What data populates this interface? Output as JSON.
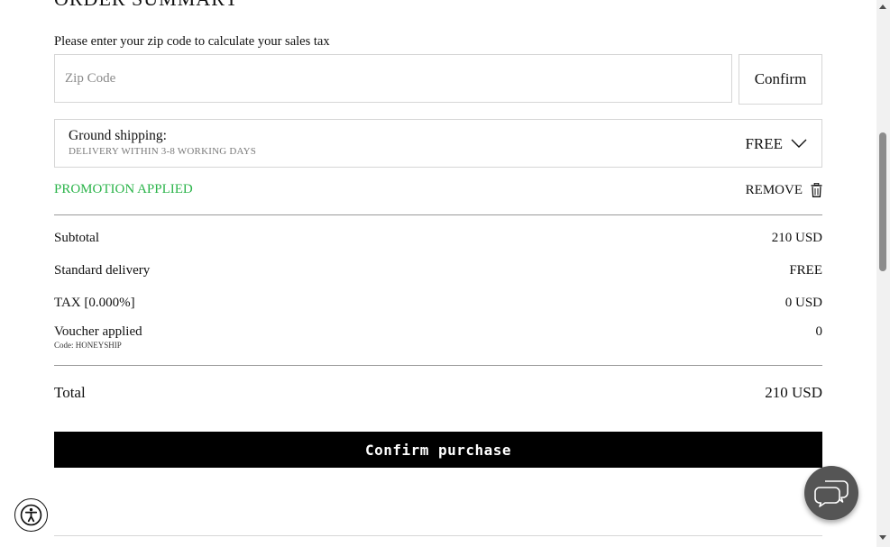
{
  "summary": {
    "heading": "ORDER SUMMARY"
  },
  "zip": {
    "label": "Please enter your zip code to calculate your sales tax",
    "placeholder": "Zip Code",
    "value": "",
    "confirm_label": "Confirm"
  },
  "shipping": {
    "title": "Ground shipping:",
    "subtitle": "DELIVERY WITHIN 3-8 WORKING DAYS",
    "price": "FREE",
    "chevron_icon": "chevron-down-icon"
  },
  "promotion": {
    "status": "PROMOTION APPLIED",
    "status_color": "#2bb44a",
    "remove_label": "REMOVE",
    "remove_icon": "trash-icon"
  },
  "totals": {
    "subtotal_label": "Subtotal",
    "subtotal_value": "210 USD",
    "delivery_label": "Standard delivery",
    "delivery_value": "FREE",
    "tax_label": "TAX [0.000%]",
    "tax_value": "0 USD",
    "voucher_label": "Voucher applied",
    "voucher_code": "Code: HONEYSHIP",
    "voucher_value": "0",
    "total_label": "Total",
    "total_value": "210 USD"
  },
  "actions": {
    "purchase_label": "Confirm purchase",
    "purchase_bg": "#000000"
  },
  "widgets": {
    "accessibility_icon": "accessibility-icon",
    "chat_icon": "chat-bubbles-icon"
  }
}
